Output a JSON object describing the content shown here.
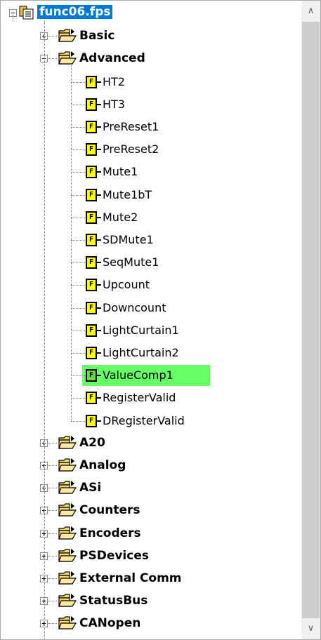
{
  "root": {
    "label": "func06.fps",
    "toggle": "−"
  },
  "folders_top": [
    {
      "label": "Basic",
      "toggle": "+"
    },
    {
      "label": "Advanced",
      "toggle": "−"
    }
  ],
  "functions": [
    {
      "label": "HT2",
      "icon": "F",
      "selected": false
    },
    {
      "label": "HT3",
      "icon": "F",
      "selected": false
    },
    {
      "label": "PreReset1",
      "icon": "F",
      "selected": false
    },
    {
      "label": "PreReset2",
      "icon": "F",
      "selected": false
    },
    {
      "label": "Mute1",
      "icon": "F",
      "selected": false
    },
    {
      "label": "Mute1bT",
      "icon": "F",
      "selected": false
    },
    {
      "label": "Mute2",
      "icon": "F",
      "selected": false
    },
    {
      "label": "SDMute1",
      "icon": "F",
      "selected": false
    },
    {
      "label": "SeqMute1",
      "icon": "F",
      "selected": false
    },
    {
      "label": "Upcount",
      "icon": "F",
      "selected": false
    },
    {
      "label": "Downcount",
      "icon": "F",
      "selected": false
    },
    {
      "label": "LightCurtain1",
      "icon": "F",
      "selected": false
    },
    {
      "label": "LightCurtain2",
      "icon": "F",
      "selected": false
    },
    {
      "label": "ValueComp1",
      "icon": "F",
      "selected": true
    },
    {
      "label": "RegisterValid",
      "icon": "F",
      "selected": false
    },
    {
      "label": "DRegisterValid",
      "icon": "F",
      "selected": false
    }
  ],
  "folders_bottom": [
    {
      "label": "A20",
      "toggle": "+"
    },
    {
      "label": "Analog",
      "toggle": "+"
    },
    {
      "label": "ASi",
      "toggle": "+"
    },
    {
      "label": "Counters",
      "toggle": "+"
    },
    {
      "label": "Encoders",
      "toggle": "+"
    },
    {
      "label": "PSDevices",
      "toggle": "+"
    },
    {
      "label": "External Comm",
      "toggle": "+"
    },
    {
      "label": "StatusBus",
      "toggle": "+"
    },
    {
      "label": "CANopen",
      "toggle": "+"
    }
  ],
  "scrollbar": {
    "up": "∧",
    "down": "∨"
  },
  "colors": {
    "selection_root": "#0078d7",
    "selection_item": "#66ff66",
    "function_icon": "#ffff00",
    "folder": "#f5d76e"
  }
}
